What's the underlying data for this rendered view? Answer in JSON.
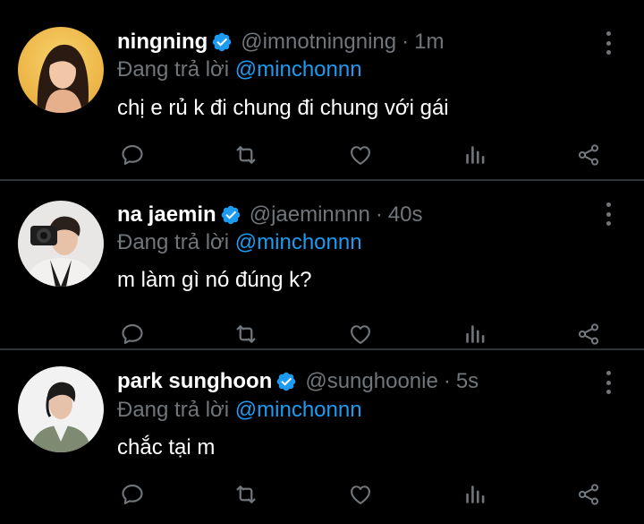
{
  "colors": {
    "background": "#000000",
    "divider": "#2f3336",
    "secondary_text": "#71767b",
    "accent": "#1d9bf0",
    "primary_text": "#ffffff"
  },
  "reply_prefix": "Đang trả lời",
  "tweets": [
    {
      "display_name": "ningning",
      "verified": true,
      "handle": "@imnotningning",
      "separator": "·",
      "time": "1m",
      "reply_to": "@minchonnn",
      "text": "chị e rủ k đi chung đi chung với gái",
      "avatar_icon": "profile-photo"
    },
    {
      "display_name": "na jaemin",
      "verified": true,
      "handle": "@jaeminnnn",
      "separator": "·",
      "time": "40s",
      "reply_to": "@minchonnn",
      "text": "m làm gì nó đúng k?",
      "avatar_icon": "profile-photo"
    },
    {
      "display_name": "park sunghoon",
      "verified": true,
      "handle": "@sunghoonie",
      "separator": "·",
      "time": "5s",
      "reply_to": "@minchonnn",
      "text": "chắc tại m",
      "avatar_icon": "profile-photo"
    }
  ],
  "action_icons": [
    "reply-icon",
    "retweet-icon",
    "like-icon",
    "views-icon",
    "share-icon"
  ]
}
